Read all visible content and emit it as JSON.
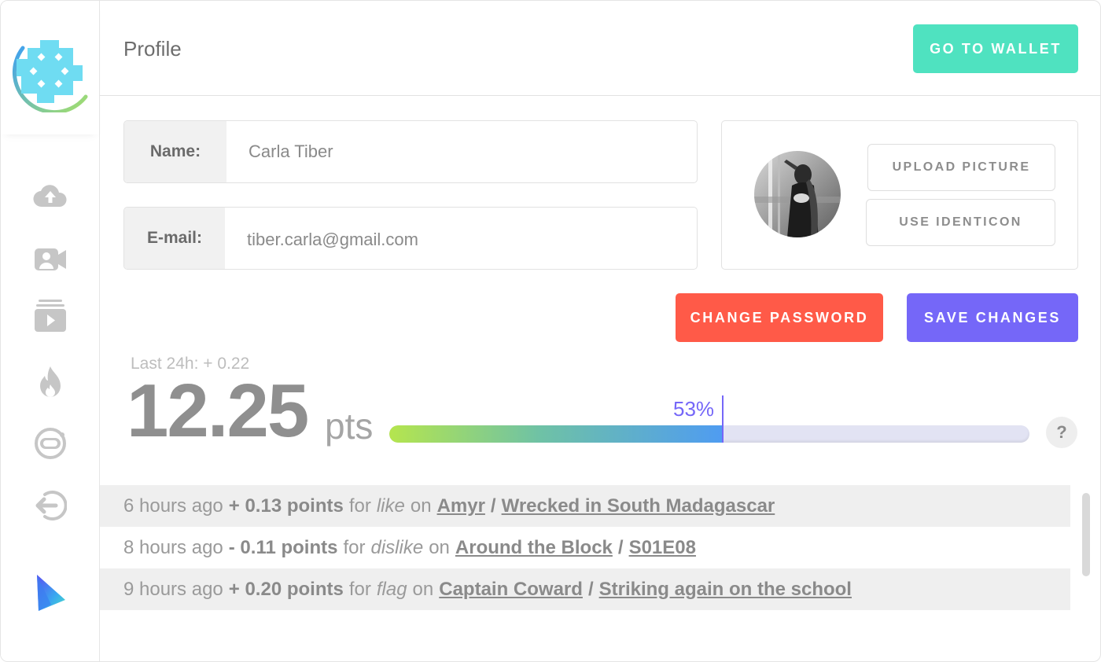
{
  "header": {
    "title": "Profile",
    "wallet_button": "GO TO WALLET"
  },
  "sidebar": {
    "items": [
      {
        "name": "upload-cloud-icon"
      },
      {
        "name": "video-camera-icon"
      },
      {
        "name": "subscriptions-icon"
      },
      {
        "name": "fire-icon"
      },
      {
        "name": "astronaut-icon"
      },
      {
        "name": "logout-icon"
      }
    ]
  },
  "form": {
    "name_label": "Name:",
    "name_value": "Carla Tiber",
    "email_label": "E-mail:",
    "email_value": "tiber.carla@gmail.com"
  },
  "picture": {
    "upload_button": "UPLOAD PICTURE",
    "identicon_button": "USE IDENTICON"
  },
  "actions": {
    "change_password": "CHANGE PASSWORD",
    "save_changes": "SAVE CHANGES"
  },
  "points": {
    "last24": "Last 24h: + 0.22",
    "value": "12.25",
    "unit": "pts",
    "progress_label": "53%",
    "progress_fraction": 0.52,
    "help": "?"
  },
  "activity": [
    {
      "time": "6 hours ago",
      "delta": "+ 0.13 points",
      "for_word": "for",
      "action": "like",
      "on_word": "on",
      "channel": "Amyr",
      "sep": "/",
      "item": "Wrecked in South Madagascar"
    },
    {
      "time": "8 hours ago",
      "delta": "- 0.11 points",
      "for_word": "for",
      "action": "dislike",
      "on_word": "on",
      "channel": "Around the Block",
      "sep": "/",
      "item": "S01E08"
    },
    {
      "time": "9 hours ago",
      "delta": "+ 0.20 points",
      "for_word": "for",
      "action": "flag",
      "on_word": "on",
      "channel": "Captain Coward",
      "sep": "/",
      "item": "Striking again on the school"
    }
  ],
  "colors": {
    "wallet": "#4fe2c0",
    "change_password": "#ff5a48",
    "save_changes": "#7567f8",
    "progress_accent": "#7567f8"
  }
}
